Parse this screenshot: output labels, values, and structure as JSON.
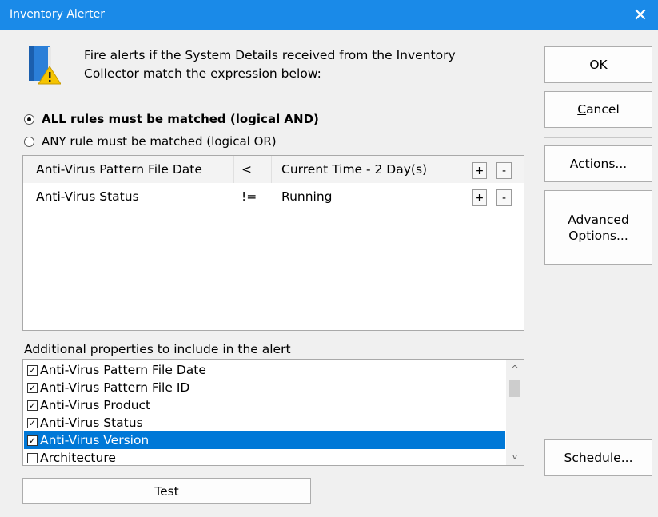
{
  "window": {
    "title": "Inventory Alerter",
    "close_glyph": "✕"
  },
  "icons": {
    "app_icon": "book-warning-icon",
    "close_icon": "close-icon"
  },
  "description": {
    "line1": "Fire alerts if the System Details received from the Inventory",
    "line2": "Collector match the expression below:"
  },
  "match_mode": {
    "all_label": "ALL rules must be matched (logical AND)",
    "any_label": "ANY rule must be matched (logical OR)",
    "selected": "all"
  },
  "rules": [
    {
      "field": "Anti-Virus Pattern File Date",
      "operator": "<",
      "value": "Current Time - 2 Day(s)",
      "add": "+",
      "remove": "-"
    },
    {
      "field": "Anti-Virus Status",
      "operator": "!=",
      "value": "Running",
      "add": "+",
      "remove": "-"
    }
  ],
  "additional": {
    "label": "Additional properties to include in the alert",
    "items": [
      {
        "label": "Anti-Virus Pattern File Date",
        "checked": true,
        "selected": false
      },
      {
        "label": "Anti-Virus Pattern File ID",
        "checked": true,
        "selected": false
      },
      {
        "label": "Anti-Virus Product",
        "checked": true,
        "selected": false
      },
      {
        "label": "Anti-Virus Status",
        "checked": true,
        "selected": false
      },
      {
        "label": "Anti-Virus Version",
        "checked": true,
        "selected": true
      },
      {
        "label": "Architecture",
        "checked": false,
        "selected": false
      }
    ],
    "scroll_up": "^",
    "scroll_down": "v",
    "check_glyph": "✓"
  },
  "buttons": {
    "ok": {
      "mnemonic": "O",
      "rest": "K"
    },
    "cancel": {
      "mnemonic": "C",
      "rest": "ancel"
    },
    "actions": {
      "pre": "Ac",
      "mnemonic": "t",
      "rest": "ions..."
    },
    "advanced_line1": "Advanced",
    "advanced_line2": "Options...",
    "schedule": "Schedule...",
    "test": "Test"
  },
  "colors": {
    "titlebar": "#1a8ae8",
    "selection": "#0078d7"
  }
}
